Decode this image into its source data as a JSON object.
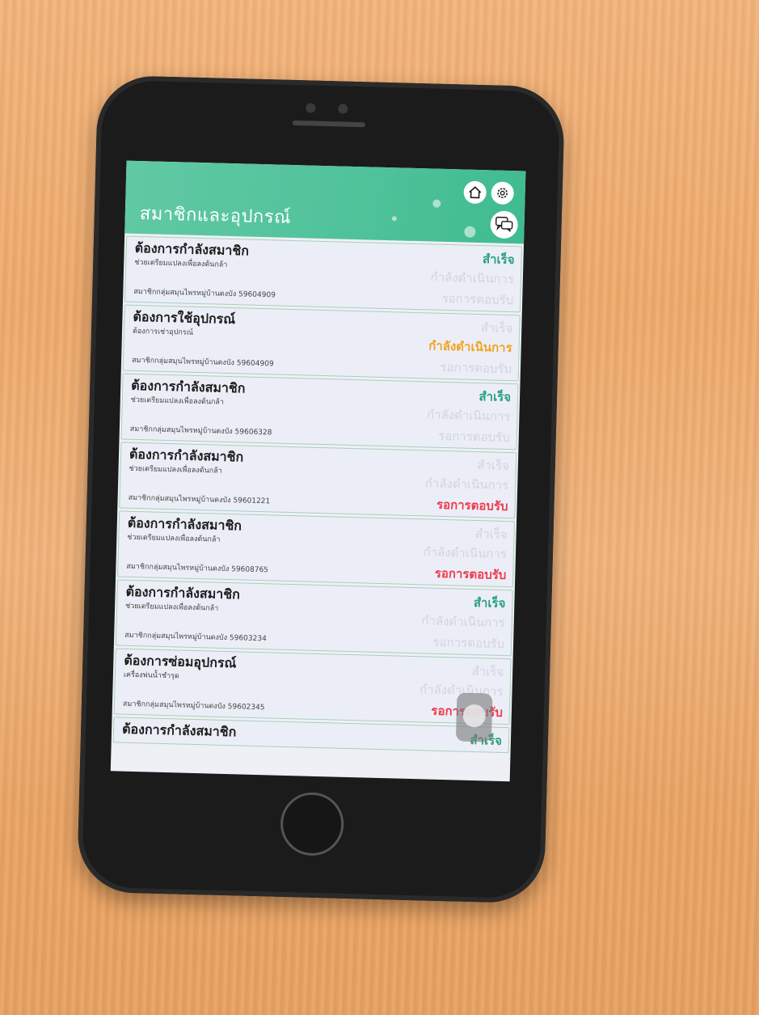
{
  "header": {
    "title": "สมาชิกและอุปกรณ์",
    "icons": [
      "home-icon",
      "gear-icon",
      "chat-icon"
    ]
  },
  "status_labels": {
    "success": "สำเร็จ",
    "progress": "กำลังดำเนินการ",
    "waiting": "รอการตอบรับ"
  },
  "colors": {
    "header": "#4fc29a",
    "success": "#2aa27c",
    "progress": "#f0a41e",
    "waiting": "#ef3b4e",
    "inactive": "#d2d4dd"
  },
  "cards": [
    {
      "title": "ต้องการกำลังสมาชิก",
      "subtitle": "ช่วยเตรียมแปลงเพื่อลงต้นกล้า",
      "member": "สมาชิกกลุ่มสมุนไพรหมู่บ้านดงบัง 59604909",
      "status": "success"
    },
    {
      "title": "ต้องการใช้อุปกรณ์",
      "subtitle": "ต้องการเช่าอุปกรณ์",
      "member": "สมาชิกกลุ่มสมุนไพรหมู่บ้านดงบัง 59604909",
      "status": "progress"
    },
    {
      "title": "ต้องการกำลังสมาชิก",
      "subtitle": "ช่วยเตรียมแปลงเพื่อลงต้นกล้า",
      "member": "สมาชิกกลุ่มสมุนไพรหมู่บ้านดงบัง 59606328",
      "status": "success"
    },
    {
      "title": "ต้องการกำลังสมาชิก",
      "subtitle": "ช่วยเตรียมแปลงเพื่อลงต้นกล้า",
      "member": "สมาชิกกลุ่มสมุนไพรหมู่บ้านดงบัง 59601221",
      "status": "waiting"
    },
    {
      "title": "ต้องการกำลังสมาชิก",
      "subtitle": "ช่วยเตรียมแปลงเพื่อลงต้นกล้า",
      "member": "สมาชิกกลุ่มสมุนไพรหมู่บ้านดงบัง 59608765",
      "status": "waiting"
    },
    {
      "title": "ต้องการกำลังสมาชิก",
      "subtitle": "ช่วยเตรียมแปลงเพื่อลงต้นกล้า",
      "member": "สมาชิกกลุ่มสมุนไพรหมู่บ้านดงบัง 59603234",
      "status": "success"
    },
    {
      "title": "ต้องการซ่อมอุปกรณ์",
      "subtitle": "เครื่องพ่นน้ำชำรุด",
      "member": "สมาชิกกลุ่มสมุนไพรหมู่บ้านดงบัง 59602345",
      "status": "waiting"
    },
    {
      "title": "ต้องการกำลังสมาชิก",
      "subtitle": "",
      "member": "",
      "status": "success"
    }
  ]
}
